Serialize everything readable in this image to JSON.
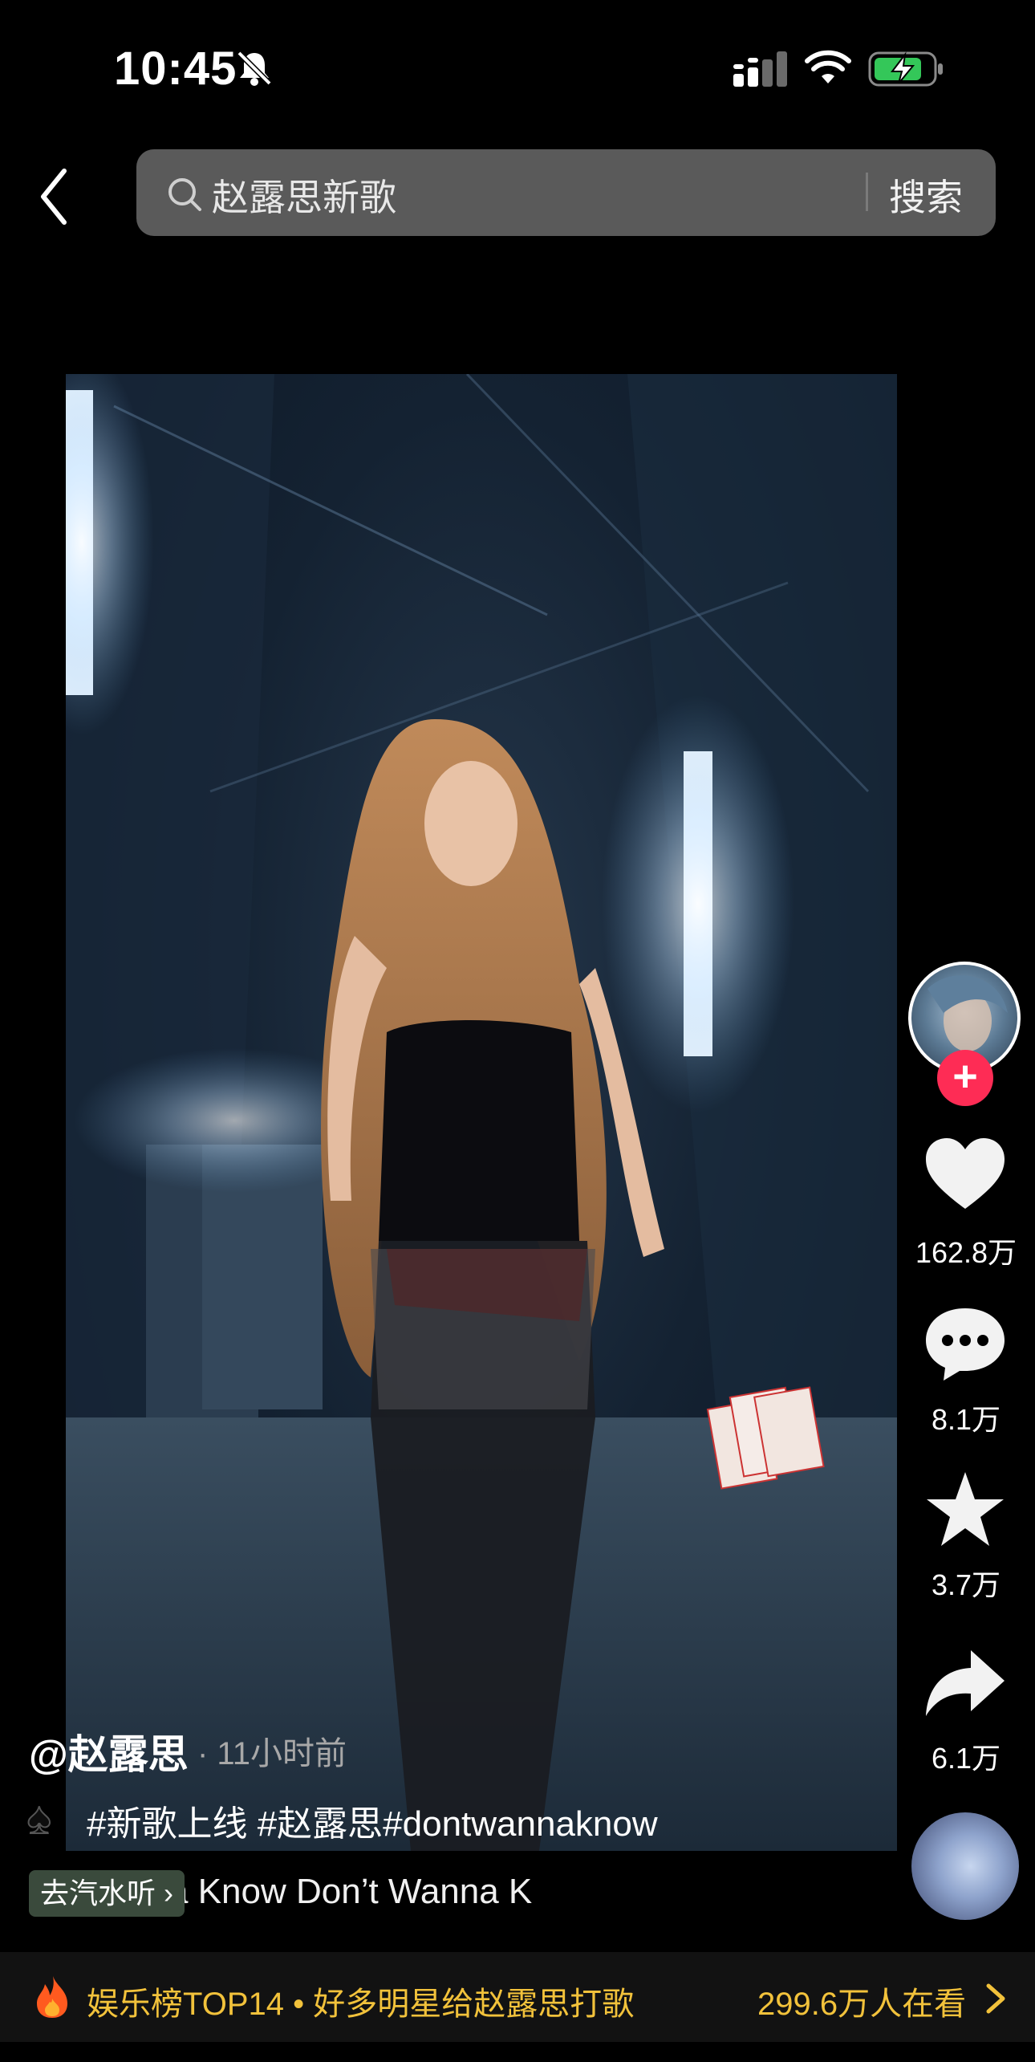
{
  "status_bar": {
    "time": "10:45"
  },
  "search": {
    "query": "赵露思新歌",
    "button": "搜索"
  },
  "actions": {
    "likes": "162.8万",
    "comments": "8.1万",
    "favorites": "3.7万",
    "shares": "6.1万"
  },
  "post": {
    "author": "@赵露思",
    "time_ago": "· 11小时前",
    "tags": "#新歌上线 #赵露思#dontwannaknow",
    "soda_button": "去汽水听",
    "song_lyrics": "a Know    Don’t Wanna K"
  },
  "banner": {
    "text": "娱乐榜TOP14 • 好多明星给赵露思打歌",
    "viewers": "299.6万人在看"
  },
  "colors": {
    "accent": "#fe2c55",
    "banner_text": "#f2c23b",
    "search_bg": "#5a5a5a"
  }
}
